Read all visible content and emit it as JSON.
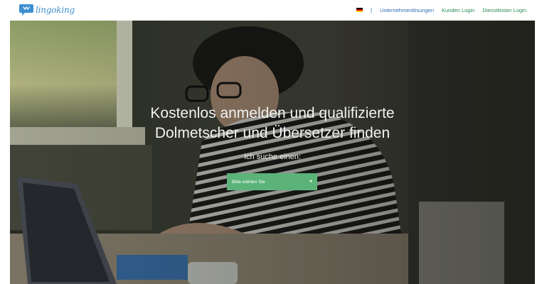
{
  "header": {
    "logo_text": "lingoking",
    "nav": {
      "separator": "|",
      "links": [
        {
          "label": "Unternehmenlösungen",
          "color": "#2b6cb0"
        },
        {
          "label": "Kunden Login",
          "color": "#2e8b57"
        },
        {
          "label": "Dienstleister Login",
          "color": "#2e8b57"
        }
      ]
    }
  },
  "hero": {
    "title_line1": "Kostenlos anmelden und qualifizierte",
    "title_line2": "Dolmetscher und Übersetzer finden",
    "subtitle": "Ich suche einen:",
    "select": {
      "value": "Bitte wählen Sie",
      "color": "#5bb37a"
    }
  },
  "colors": {
    "brand_blue": "#3e8fd0",
    "accent_green": "#5bb37a"
  }
}
